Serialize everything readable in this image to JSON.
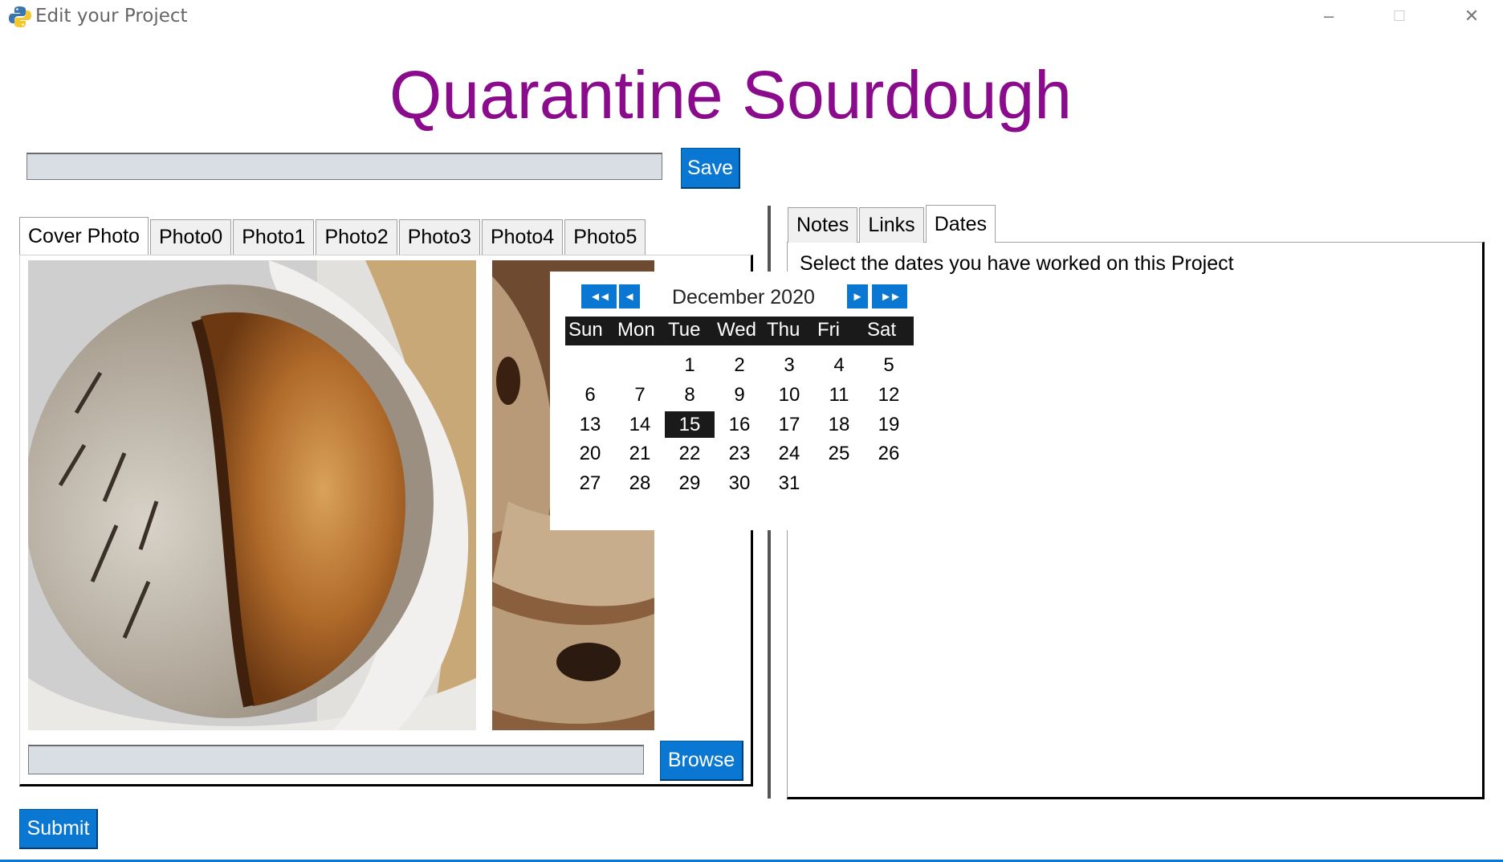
{
  "window": {
    "title": "Edit your Project",
    "minimize": "–",
    "maximize": "☐",
    "close": "✕"
  },
  "heading": "Quarantine Sourdough",
  "project_name": {
    "value": "",
    "save_label": "Save"
  },
  "photo_tabs": [
    "Cover Photo",
    "Photo0",
    "Photo1",
    "Photo2",
    "Photo3",
    "Photo4",
    "Photo5"
  ],
  "photo_tabs_active": "Cover Photo",
  "photo_path": {
    "value": "",
    "browse_label": "Browse"
  },
  "right_tabs": [
    "Notes",
    "Links",
    "Dates"
  ],
  "right_tabs_active": "Dates",
  "dates": {
    "instructions": "Select the dates you have worked on this Project"
  },
  "calendar": {
    "month_label": "December 2020",
    "prev_year": "◄◄",
    "prev_month": "◄",
    "next_month": "►",
    "next_year": "►►",
    "weekdays": [
      "Sun",
      "Mon",
      "Tue",
      "Wed",
      "Thu",
      "Fri",
      "Sat"
    ],
    "weeks": [
      [
        "",
        "",
        "1",
        "2",
        "3",
        "4",
        "5"
      ],
      [
        "6",
        "7",
        "8",
        "9",
        "10",
        "11",
        "12"
      ],
      [
        "13",
        "14",
        "15",
        "16",
        "17",
        "18",
        "19"
      ],
      [
        "20",
        "21",
        "22",
        "23",
        "24",
        "25",
        "26"
      ],
      [
        "27",
        "28",
        "29",
        "30",
        "31",
        "",
        ""
      ]
    ],
    "selected_day": "15"
  },
  "submit_label": "Submit",
  "colors": {
    "heading": "#8a0b8c",
    "button": "#0a78d2",
    "calendar_header": "#1a1a1a"
  }
}
